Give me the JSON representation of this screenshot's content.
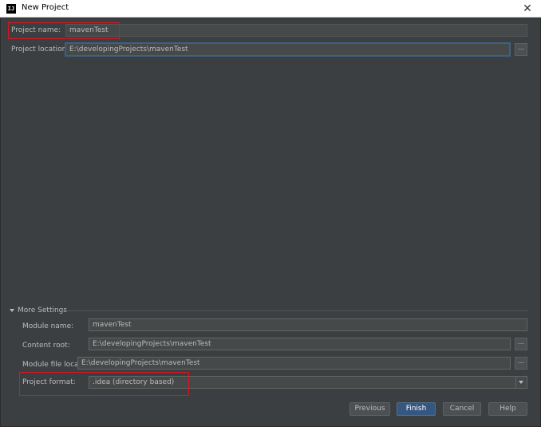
{
  "window": {
    "title": "New Project",
    "close_glyph": "✕",
    "app_icon_text": "IJ"
  },
  "project": {
    "name_label": "Project name:",
    "name_value": "mavenTest",
    "location_label": "Project location:",
    "location_value": "E:\\developingProjects\\mavenTest",
    "browse_label": "..."
  },
  "more_settings": {
    "header": "More Settings",
    "module_name_label": "Module name:",
    "module_name_value": "mavenTest",
    "content_root_label": "Content root:",
    "content_root_value": "E:\\developingProjects\\mavenTest",
    "module_file_location_label": "Module file location:",
    "module_file_location_value": "E:\\developingProjects\\mavenTest",
    "project_format_label": "Project format:",
    "project_format_value": ".idea (directory based)",
    "browse_label": "..."
  },
  "buttons": {
    "previous": "Previous",
    "finish": "Finish",
    "cancel": "Cancel",
    "help": "Help"
  },
  "colors": {
    "highlight": "#e0141e",
    "default_button": "#365880",
    "focus": "#3d6185"
  }
}
